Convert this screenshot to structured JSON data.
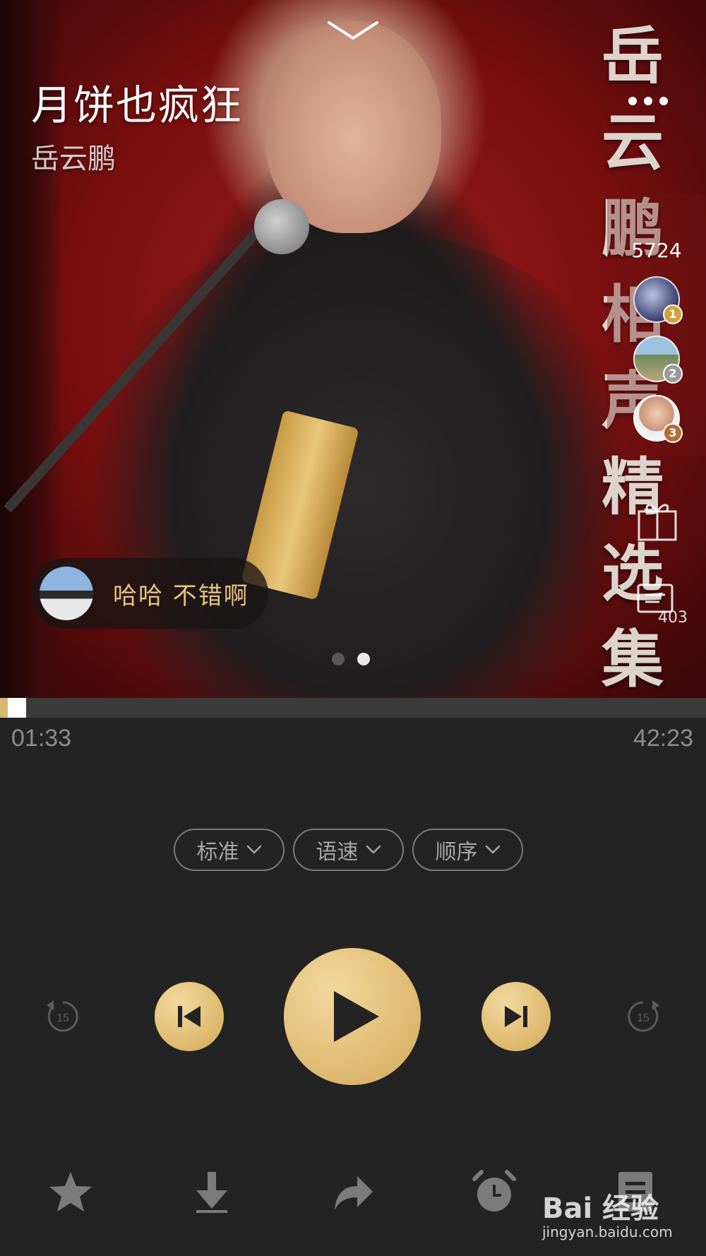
{
  "player": {
    "title": "月饼也疯狂",
    "artist": "岳云鹏",
    "album_title_chars": [
      "岳",
      "云",
      "鹏",
      "相",
      "声",
      "精",
      "选",
      "集"
    ],
    "listener_count": "5724",
    "comment_count": "403",
    "ranks": [
      {
        "rank": "1",
        "badge_color": "#d4a23a"
      },
      {
        "rank": "2",
        "badge_color": "#9a9a9a"
      },
      {
        "rank": "3",
        "badge_color": "#b0703a"
      }
    ],
    "danmaku_text": "哈哈  不错啊",
    "page_count": 2,
    "active_page": 2
  },
  "progress": {
    "current": "01:33",
    "total": "42:23",
    "fraction": 0.037
  },
  "selectors": [
    {
      "label": "标准",
      "name": "quality-select"
    },
    {
      "label": "语速",
      "name": "speed-select"
    },
    {
      "label": "顺序",
      "name": "order-select"
    }
  ],
  "controls": {
    "rewind_seconds": "15",
    "forward_seconds": "15"
  },
  "toolbar": {
    "icons": [
      "star-icon",
      "download-icon",
      "share-icon",
      "alarm-icon",
      "playlist-icon"
    ]
  },
  "watermark": {
    "logo": "Bai 经验",
    "url": "jingyan.baidu.com"
  },
  "colors": {
    "accent_gold": "#e2bf77",
    "background": "#232323",
    "danmaku_text": "#e8c37b"
  }
}
